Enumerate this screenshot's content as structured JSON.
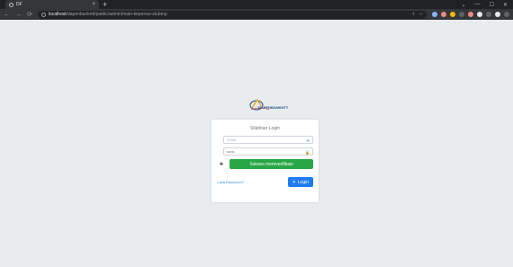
{
  "browser": {
    "tab_title": "DF",
    "tab_close": "×",
    "new_tab": "+",
    "window_controls": [
      "⌄",
      "—",
      "☐",
      "✕"
    ],
    "nav": {
      "back": "←",
      "forward": "→",
      "reload": "⟳"
    },
    "url_host": "localhost",
    "url_path": "/dapenbankntt/public/admin/main-keperasi-stubmp",
    "omnibox_icons": {
      "share": "⇪",
      "bookmark": "☆"
    }
  },
  "login": {
    "logo_text": "DAPENBANKNTT",
    "title": "Silahkan Login",
    "email_placeholder": "Email",
    "password_value": "••••••",
    "verify_button": "Sukses memverifikasi",
    "forgot_link": "Lupa Password?",
    "login_button": "Login",
    "icons": {
      "email": "✉",
      "password": "🔒",
      "verify": "♣",
      "login": "✈"
    }
  },
  "colors": {
    "background": "#e9ecef",
    "verify_green": "#28a745",
    "login_blue": "#1d7bf2",
    "link_blue": "#2c8ef8"
  }
}
